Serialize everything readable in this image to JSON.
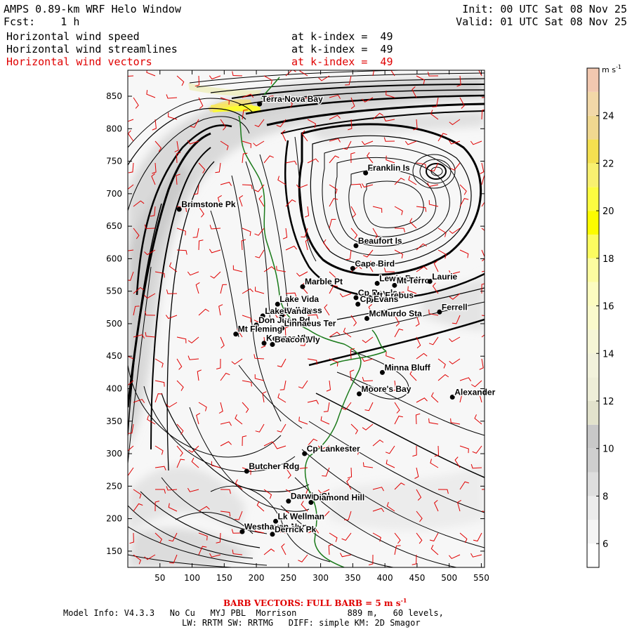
{
  "header": {
    "title": "AMPS 0.89-km WRF Helo Window",
    "forecast": "Fcst:    1 h",
    "init": "Init: 00 UTC Sat 08 Nov 25",
    "valid": "Valid: 01 UTC Sat 08 Nov 25",
    "fields": [
      {
        "name": "Horizontal wind speed",
        "level": "at k-index =  49",
        "color": "#000000"
      },
      {
        "name": "Horizontal wind streamlines",
        "level": "at k-index =  49",
        "color": "#000000"
      },
      {
        "name": "Horizontal wind vectors",
        "level": "at k-index =  49",
        "color": "#e00000"
      }
    ]
  },
  "map": {
    "x_ticks": [
      "50",
      "100",
      "150",
      "200",
      "250",
      "300",
      "350",
      "400",
      "450",
      "500",
      "550"
    ],
    "y_ticks": [
      "850",
      "800",
      "750",
      "700",
      "650",
      "600",
      "550",
      "500",
      "450",
      "400",
      "350",
      "300",
      "250",
      "200",
      "150"
    ],
    "x_range": [
      0,
      555
    ],
    "y_range": [
      125,
      890
    ],
    "places": [
      {
        "name": "Terra Nova Bay",
        "x": 205,
        "y": 838
      },
      {
        "name": "Franklin Is",
        "x": 370,
        "y": 732
      },
      {
        "name": "Brimstone Pk",
        "x": 80,
        "y": 676
      },
      {
        "name": "Beaufort Is",
        "x": 355,
        "y": 620
      },
      {
        "name": "Cape Bird",
        "x": 350,
        "y": 585
      },
      {
        "name": "Lewis Bay",
        "x": 388,
        "y": 562
      },
      {
        "name": "Mt Terror",
        "x": 415,
        "y": 559
      },
      {
        "name": "Laurie",
        "x": 470,
        "y": 565
      },
      {
        "name": "Marble Pt",
        "x": 272,
        "y": 557
      },
      {
        "name": "Cp Royds",
        "x": 355,
        "y": 540
      },
      {
        "name": "Mt Erebus",
        "x": 378,
        "y": 536
      },
      {
        "name": "Cp Evans",
        "x": 358,
        "y": 530
      },
      {
        "name": "Lake Vida",
        "x": 233,
        "y": 530
      },
      {
        "name": "Ferrell",
        "x": 485,
        "y": 518
      },
      {
        "name": "McMurdo Sta",
        "x": 372,
        "y": 508
      },
      {
        "name": "Bull Pass",
        "x": 240,
        "y": 513
      },
      {
        "name": "Lake Vanda",
        "x": 210,
        "y": 512
      },
      {
        "name": "Don Juan Pd",
        "x": 200,
        "y": 498
      },
      {
        "name": "Linnaeus Ter",
        "x": 240,
        "y": 493
      },
      {
        "name": "Mt Fleming",
        "x": 168,
        "y": 484
      },
      {
        "name": "Kennar Vly",
        "x": 212,
        "y": 470
      },
      {
        "name": "Beacon Vly",
        "x": 225,
        "y": 468
      },
      {
        "name": "Minna Bluff",
        "x": 396,
        "y": 425
      },
      {
        "name": "Moore's Bay",
        "x": 360,
        "y": 392
      },
      {
        "name": "Alexander",
        "x": 505,
        "y": 387
      },
      {
        "name": "Cp Lankester",
        "x": 275,
        "y": 300
      },
      {
        "name": "Butcher Rdg",
        "x": 185,
        "y": 273
      },
      {
        "name": "Darwin Gl",
        "x": 250,
        "y": 227
      },
      {
        "name": "Diamond Hill",
        "x": 285,
        "y": 225
      },
      {
        "name": "Lk Wellman",
        "x": 230,
        "y": 196
      },
      {
        "name": "Westhaven Nun",
        "x": 178,
        "y": 180
      },
      {
        "name": "Derrick Pk",
        "x": 225,
        "y": 176
      }
    ]
  },
  "colorbar": {
    "unit": "m s",
    "unit_exp": "-1",
    "ticks": [
      "24",
      "22",
      "20",
      "18",
      "16",
      "14",
      "12",
      "10",
      "8",
      "6"
    ],
    "colors": [
      "#f4f4f4",
      "#e6e6e6",
      "#d2d2d2",
      "#c6c6c6",
      "#e4e4cc",
      "#f4f4d4",
      "#fafac8",
      "#fcfc9c",
      "#fcfc30",
      "#fcf000",
      "#f8e070",
      "#f8d8a0",
      "#f4c8a8"
    ],
    "bands": [
      {
        "label": "5-6",
        "color": "#ffffff"
      },
      {
        "label": "6-7",
        "color": "#f4f4f4"
      },
      {
        "label": "7-8",
        "color": "#ececec"
      },
      {
        "label": "8-9",
        "color": "#dedede"
      },
      {
        "label": "9-10",
        "color": "#cfcfcf"
      },
      {
        "label": "10-11",
        "color": "#c8c8c8"
      },
      {
        "label": "11-12",
        "color": "#e2e2cc"
      },
      {
        "label": "12-13",
        "color": "#eeeed8"
      },
      {
        "label": "13-14",
        "color": "#f2f2dc"
      },
      {
        "label": "14-15",
        "color": "#f6f6d6"
      },
      {
        "label": "15-16",
        "color": "#fafacc"
      },
      {
        "label": "16-17",
        "color": "#fcfcc0"
      },
      {
        "label": "17-18",
        "color": "#fcfca0"
      },
      {
        "label": "18-19",
        "color": "#fcfc60"
      },
      {
        "label": "19-20",
        "color": "#fcfc00"
      },
      {
        "label": "20-21",
        "color": "#fcfc40"
      },
      {
        "label": "21-22",
        "color": "#f8f070"
      },
      {
        "label": "22-23",
        "color": "#f4e050"
      },
      {
        "label": "23-24",
        "color": "#f0d890"
      },
      {
        "label": "24-25",
        "color": "#f2d8a8"
      },
      {
        "label": "25-26",
        "color": "#f2c8b0"
      }
    ]
  },
  "footer": {
    "barb_note": "BARB VECTORS:  FULL BARB = 5 m s",
    "barb_exp": "-1",
    "model_line": "Model Info: V4.3.3   No Cu   MYJ PBL  Morrison          889 m,   60 levels,",
    "physics_line": "LW: RRTM SW: RRTMG   DIFF: simple KM: 2D Smagor"
  },
  "colors": {
    "coast": "#1a7a1a",
    "vectors": "#e00000",
    "text": "#000000"
  }
}
